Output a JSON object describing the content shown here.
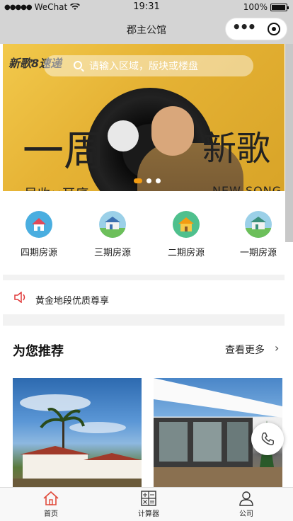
{
  "status_bar": {
    "carrier": "WeChat",
    "time": "19:31",
    "battery": "100%"
  },
  "nav": {
    "title": "郡主公馆"
  },
  "banner": {
    "logo_text": "新歌8速递",
    "headline_left": "一周",
    "headline_right": "新歌",
    "subline_left": "尽收×耳底",
    "subline_right": "NEW SONG"
  },
  "search": {
    "placeholder": "请输入区域，版块或楼盘"
  },
  "categories": [
    {
      "label": "四期房源",
      "icon": "house-icon"
    },
    {
      "label": "三期房源",
      "icon": "villa-icon"
    },
    {
      "label": "二期房源",
      "icon": "home-icon"
    },
    {
      "label": "一期房源",
      "icon": "villa-icon"
    }
  ],
  "notice": {
    "text": "黄金地段优质尊享"
  },
  "recommend": {
    "title": "为您推荐",
    "more": "查看更多"
  },
  "tabbar": [
    {
      "label": "首页",
      "icon": "home-icon"
    },
    {
      "label": "计算器",
      "icon": "calculator-icon"
    },
    {
      "label": "公司",
      "icon": "person-icon"
    }
  ],
  "colors": {
    "accent": "#f39c12",
    "home_tab_icon": "#e04a3a",
    "banner_yellow": "#f2c94c",
    "speaker_red": "#e03a3a"
  }
}
